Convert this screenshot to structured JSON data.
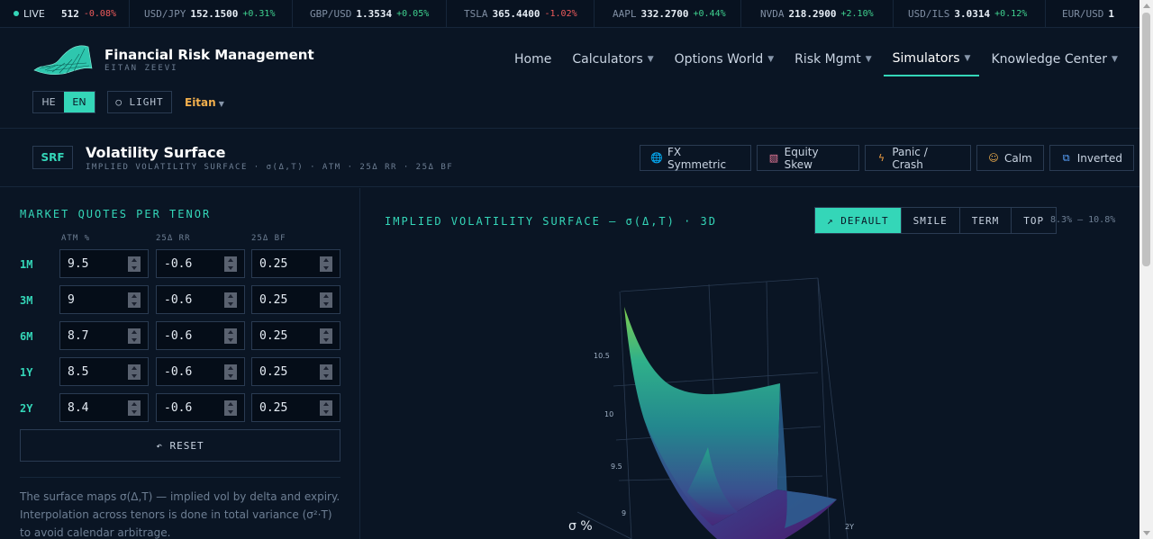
{
  "ticker": {
    "live_label": "LIVE",
    "items": [
      {
        "sym": "",
        "px": "512",
        "chg": "-0.08%",
        "dir": "dn"
      },
      {
        "sym": "USD/JPY",
        "px": "152.1500",
        "chg": "+0.31%",
        "dir": "up"
      },
      {
        "sym": "GBP/USD",
        "px": "1.3534",
        "chg": "+0.05%",
        "dir": "up"
      },
      {
        "sym": "TSLA",
        "px": "365.4400",
        "chg": "-1.02%",
        "dir": "dn"
      },
      {
        "sym": "AAPL",
        "px": "332.2700",
        "chg": "+0.44%",
        "dir": "up"
      },
      {
        "sym": "NVDA",
        "px": "218.2900",
        "chg": "+2.10%",
        "dir": "up"
      },
      {
        "sym": "USD/ILS",
        "px": "3.0314",
        "chg": "+0.12%",
        "dir": "up"
      },
      {
        "sym": "EUR/USD",
        "px": "1",
        "chg": "",
        "dir": "up"
      }
    ]
  },
  "brand": {
    "title": "Financial Risk Management",
    "subtitle": "EITAN ZEEVI"
  },
  "nav": [
    {
      "label": "Home",
      "caret": false,
      "active": false
    },
    {
      "label": "Calculators",
      "caret": true,
      "active": false
    },
    {
      "label": "Options World",
      "caret": true,
      "active": false
    },
    {
      "label": "Risk Mgmt",
      "caret": true,
      "active": false
    },
    {
      "label": "Simulators",
      "caret": true,
      "active": true
    },
    {
      "label": "Knowledge Center",
      "caret": true,
      "active": false
    }
  ],
  "lang": {
    "he": "HE",
    "en": "EN",
    "selected": "EN"
  },
  "theme_label": "○ LIGHT",
  "user_label": "Eitan",
  "page": {
    "badge": "SRF",
    "title": "Volatility Surface",
    "subtitle": "IMPLIED VOLATILITY SURFACE · σ(Δ,T) · ATM · 25Δ RR · 25Δ BF"
  },
  "presets": [
    {
      "label": "FX Symmetric",
      "icon": "globe-icon"
    },
    {
      "label": "Equity Skew",
      "icon": "chart-icon"
    },
    {
      "label": "Panic / Crash",
      "icon": "lightning-icon"
    },
    {
      "label": "Calm",
      "icon": "calm-face-icon"
    },
    {
      "label": "Inverted",
      "icon": "inverted-icon"
    }
  ],
  "quotes": {
    "title": "MARKET QUOTES PER TENOR",
    "columns": [
      "ATM %",
      "25Δ RR",
      "25Δ BF"
    ],
    "rows": [
      {
        "tenor": "1M",
        "atm": "9.5",
        "rr": "-0.6",
        "bf": "0.25"
      },
      {
        "tenor": "3M",
        "atm": "9",
        "rr": "-0.6",
        "bf": "0.25"
      },
      {
        "tenor": "6M",
        "atm": "8.7",
        "rr": "-0.6",
        "bf": "0.25"
      },
      {
        "tenor": "1Y",
        "atm": "8.5",
        "rr": "-0.6",
        "bf": "0.25"
      },
      {
        "tenor": "2Y",
        "atm": "8.4",
        "rr": "-0.6",
        "bf": "0.25"
      }
    ],
    "reset_label": "↶ RESET",
    "note": "The surface maps σ(Δ,T) — implied vol by delta and expiry. Interpolation across tenors is done in total variance (σ²·T) to avoid calendar arbitrage."
  },
  "chart": {
    "title": "IMPLIED VOLATILITY SURFACE — σ(Δ,T) · 3D",
    "views": [
      {
        "label": "↗ DEFAULT",
        "active": true
      },
      {
        "label": "SMILE",
        "active": false
      },
      {
        "label": "TERM",
        "active": false
      },
      {
        "label": "TOP",
        "active": false
      }
    ],
    "range_label": "8.3% — 10.8%",
    "z_axis_label": "σ %",
    "z_ticks": [
      "10.5",
      "10",
      "9.5",
      "9"
    ],
    "tenor_tick": "2Y"
  },
  "colors": {
    "accent": "#34d6b8",
    "up": "#3fd18f",
    "down": "#ef5b5b",
    "user": "#f3b04d"
  }
}
